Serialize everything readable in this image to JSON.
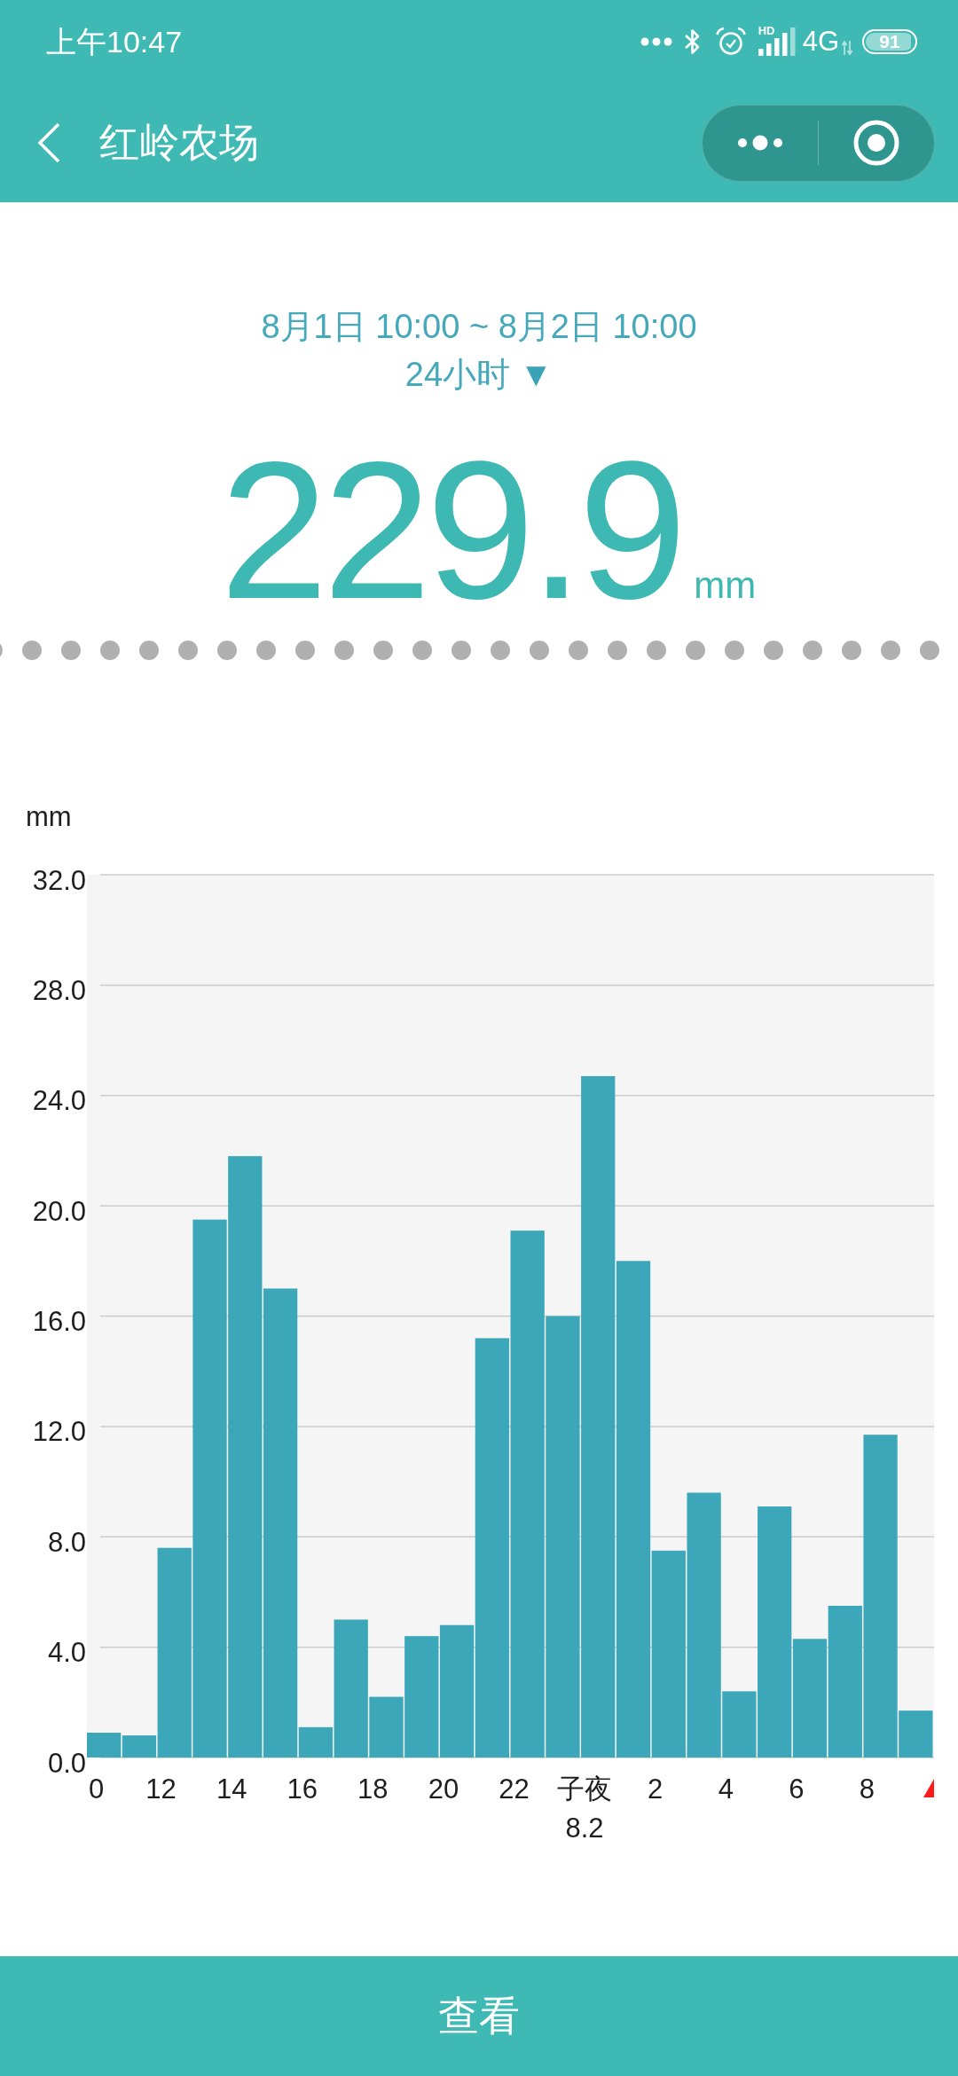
{
  "status_bar": {
    "time": "上午10:47",
    "signal_label": "HD",
    "network": "4G",
    "battery": "91"
  },
  "nav_bar": {
    "title": "红岭农场"
  },
  "summary": {
    "range": "8月1日 10:00 ~ 8月2日 10:00",
    "period": "24小时",
    "period_caret": "▼",
    "total": "229.9",
    "unit": "mm"
  },
  "chart": {
    "chart_data": {
      "type": "bar",
      "ylabel": "mm",
      "categories": [
        "0",
        null,
        "12",
        null,
        "14",
        null,
        "16",
        null,
        "18",
        null,
        "20",
        null,
        "22",
        null,
        "子夜\n8.2",
        null,
        "2",
        null,
        "4",
        null,
        "6",
        null,
        "8",
        null
      ],
      "values": [
        0.9,
        0.8,
        7.6,
        19.5,
        21.8,
        17.0,
        1.1,
        5.0,
        2.2,
        4.4,
        4.8,
        15.2,
        19.1,
        16.0,
        24.7,
        18.0,
        7.5,
        9.6,
        2.4,
        9.1,
        4.3,
        5.5,
        11.7,
        1.7
      ],
      "ylim": [
        0,
        32
      ],
      "grid": true,
      "yticks": [
        {
          "value": 0,
          "label": "0.0"
        },
        {
          "value": 4,
          "label": "4.0"
        },
        {
          "value": 8,
          "label": "8.0"
        },
        {
          "value": 12,
          "label": "12.0"
        },
        {
          "value": 16,
          "label": "16.0"
        },
        {
          "value": 20,
          "label": "20.0"
        },
        {
          "value": 24,
          "label": "24.0"
        },
        {
          "value": 28,
          "label": "28.0"
        },
        {
          "value": 32,
          "label": "32.0"
        }
      ]
    }
  },
  "footer": {
    "button": "查看"
  }
}
